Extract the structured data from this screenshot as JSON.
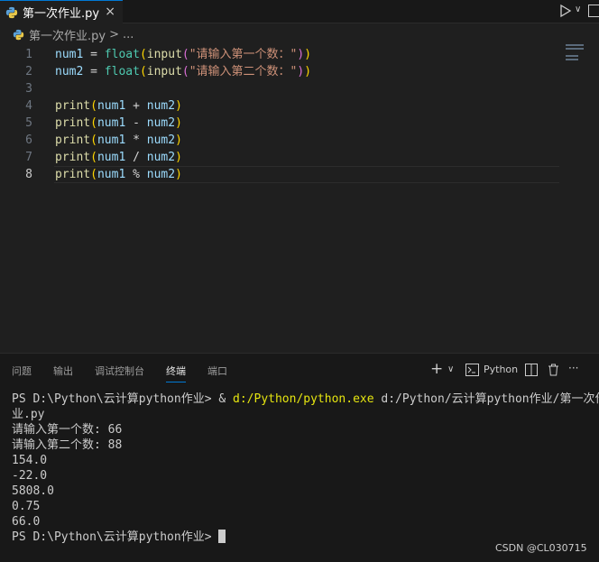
{
  "tab": {
    "title": "第一次作业.py",
    "close": "×"
  },
  "breadcrumb": {
    "file": "第一次作业.py",
    "sep": ">",
    "more": "..."
  },
  "editor": {
    "lines": [
      {
        "num": "1",
        "tokens": [
          [
            "var",
            "num1"
          ],
          [
            "op",
            " = "
          ],
          [
            "id",
            "float"
          ],
          [
            "br",
            "("
          ],
          [
            "fn",
            "input"
          ],
          [
            "br2",
            "("
          ],
          [
            "str",
            "\"请输入第一个数：\""
          ],
          [
            "br2",
            ")"
          ],
          [
            "br",
            ")"
          ]
        ]
      },
      {
        "num": "2",
        "tokens": [
          [
            "var",
            "num2"
          ],
          [
            "op",
            " = "
          ],
          [
            "id",
            "float"
          ],
          [
            "br",
            "("
          ],
          [
            "fn",
            "input"
          ],
          [
            "br2",
            "("
          ],
          [
            "str",
            "\"请输入第二个数：\""
          ],
          [
            "br2",
            ")"
          ],
          [
            "br",
            ")"
          ]
        ]
      },
      {
        "num": "3",
        "tokens": []
      },
      {
        "num": "4",
        "tokens": [
          [
            "fn",
            "print"
          ],
          [
            "br",
            "("
          ],
          [
            "var",
            "num1"
          ],
          [
            "op",
            " + "
          ],
          [
            "var",
            "num2"
          ],
          [
            "br",
            ")"
          ]
        ]
      },
      {
        "num": "5",
        "tokens": [
          [
            "fn",
            "print"
          ],
          [
            "br",
            "("
          ],
          [
            "var",
            "num1"
          ],
          [
            "op",
            " - "
          ],
          [
            "var",
            "num2"
          ],
          [
            "br",
            ")"
          ]
        ]
      },
      {
        "num": "6",
        "tokens": [
          [
            "fn",
            "print"
          ],
          [
            "br",
            "("
          ],
          [
            "var",
            "num1"
          ],
          [
            "op",
            " * "
          ],
          [
            "var",
            "num2"
          ],
          [
            "br",
            ")"
          ]
        ]
      },
      {
        "num": "7",
        "tokens": [
          [
            "fn",
            "print"
          ],
          [
            "br",
            "("
          ],
          [
            "var",
            "num1"
          ],
          [
            "op",
            " / "
          ],
          [
            "var",
            "num2"
          ],
          [
            "br",
            ")"
          ]
        ]
      },
      {
        "num": "8",
        "tokens": [
          [
            "fn",
            "print"
          ],
          [
            "br",
            "("
          ],
          [
            "var",
            "num1"
          ],
          [
            "op",
            " % "
          ],
          [
            "var",
            "num2"
          ],
          [
            "br",
            ")"
          ]
        ]
      }
    ]
  },
  "panel": {
    "tabs": [
      "问题",
      "输出",
      "调试控制台",
      "终端",
      "端口"
    ],
    "active_tab": "终端",
    "add": "+",
    "dropdown": "∨",
    "terminal_profile": "Python",
    "more": "···"
  },
  "terminal": {
    "prompt1": "PS D:\\Python\\云计算python作业> & ",
    "cmd": "d:/Python/python.exe",
    "args": " d:/Python/云计算python作业/第一次作",
    "args_wrap": "业.py",
    "out1": "请输入第一个数: 66",
    "out2": "请输入第二个数: 88",
    "res1": "154.0",
    "res2": "-22.0",
    "res3": "5808.0",
    "res4": "0.75",
    "res5": "66.0",
    "prompt2": "PS D:\\Python\\云计算python作业> "
  },
  "watermark": "CSDN @CL030715",
  "icons": {
    "python": "python-icon",
    "run": "run-icon",
    "split": "split-editor-icon"
  }
}
